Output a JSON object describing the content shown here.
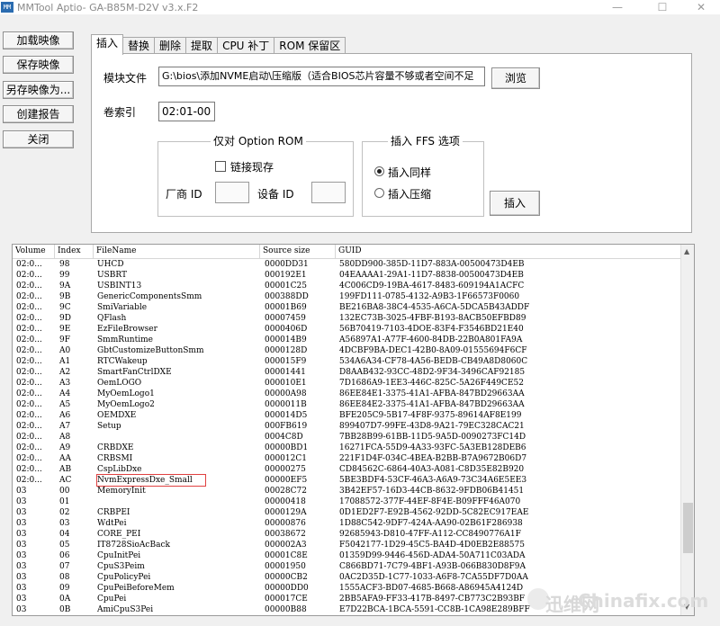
{
  "window": {
    "title": "MMTool Aptio- GA-B85M-D2V v3.x.F2",
    "icon_label": "MM",
    "controls": {
      "minimize": "—",
      "maximize": "☐",
      "close": "✕"
    }
  },
  "left_buttons": [
    "加载映像",
    "保存映像",
    "另存映像为...",
    "创建报告",
    "关闭"
  ],
  "tabs": [
    "插入",
    "替换",
    "删除",
    "提取",
    "CPU 补丁",
    "ROM 保留区"
  ],
  "active_tab": "插入",
  "insert_panel": {
    "module_file_label": "模块文件",
    "module_file_value": "G:\\bios\\添加NVME启动\\压缩版（适合BIOS芯片容量不够或者空间不足",
    "browse_button": "浏览",
    "volume_index_label": "卷索引",
    "volume_index_value": "02:01-00",
    "option_rom_group": {
      "title": "仅对 Option ROM",
      "link_existing": "链接现存",
      "vendor_id_label": "厂商 ID",
      "device_id_label": "设备 ID"
    },
    "ffs_group": {
      "title": "插入 FFS 选项",
      "option_same": "插入同样",
      "option_compress": "插入压缩"
    },
    "insert_button": "插入"
  },
  "table": {
    "headers": [
      "Volume",
      "Index",
      "FileName",
      "Source size",
      "GUID"
    ],
    "rows": [
      [
        "02:0...",
        "98",
        "UHCD",
        "0000DD31",
        "580DD900-385D-11D7-883A-00500473D4EB"
      ],
      [
        "02:0...",
        "99",
        "USBRT",
        "000192E1",
        "04EAAAA1-29A1-11D7-8838-00500473D4EB"
      ],
      [
        "02:0...",
        "9A",
        "USBINT13",
        "00001C25",
        "4C006CD9-19BA-4617-8483-609194A1ACFC"
      ],
      [
        "02:0...",
        "9B",
        "GenericComponentsSmm",
        "000388DD",
        "199FD111-0785-4132-A9B3-1F66573F0060"
      ],
      [
        "02:0...",
        "9C",
        "SmiVariable",
        "00001B69",
        "BE216BA8-38C4-4535-A6CA-5DCA5B43ADDF"
      ],
      [
        "02:0...",
        "9D",
        "QFlash",
        "00007459",
        "132EC73B-3025-4FBF-B193-8ACB50EFBD89"
      ],
      [
        "02:0...",
        "9E",
        "EzFileBrowser",
        "0000406D",
        "56B70419-7103-4DOE-83F4-F3546BD21E40"
      ],
      [
        "02:0...",
        "9F",
        "SmmRuntime",
        "000014B9",
        "A56897A1-A77F-4600-84DB-22B0A801FA9A"
      ],
      [
        "02:0...",
        "A0",
        "GbtCustomizeButtonSmm",
        "0000128D",
        "4DCBF9BA-DEC1-42B0-8A09-01555694F6CF"
      ],
      [
        "02:0...",
        "A1",
        "RTCWakeup",
        "000015F9",
        "534A6A34-CF78-4A56-BEDB-CB49A8D8060C"
      ],
      [
        "02:0...",
        "A2",
        "SmartFanCtrlDXE",
        "00001441",
        "D8AAB432-93CC-48D2-9F34-3496CAF92185"
      ],
      [
        "02:0...",
        "A3",
        "OemLOGO",
        "000010E1",
        "7D1686A9-1EE3-446C-825C-5A26F449CE52"
      ],
      [
        "02:0...",
        "A4",
        "MyOemLogo1",
        "00000A98",
        "86EE84E1-3375-41A1-AFBA-847BD29663AA"
      ],
      [
        "02:0...",
        "A5",
        "MyOemLogo2",
        "0000011B",
        "86EE84E2-3375-41A1-AFBA-847BD29663AA"
      ],
      [
        "02:0...",
        "A6",
        "OEMDXE",
        "000014D5",
        "BFE205C9-5B17-4F8F-9375-89614AF8E199"
      ],
      [
        "02:0...",
        "A7",
        "Setup",
        "000FB619",
        "899407D7-99FE-43D8-9A21-79EC328CAC21"
      ],
      [
        "02:0...",
        "A8",
        "",
        "0004C8D",
        "7BB28B99-61BB-11D5-9A5D-0090273FC14D"
      ],
      [
        "02:0...",
        "A9",
        "CRBDXE",
        "00000BD1",
        "16271FCA-55D9-4A33-93FC-5A3EB128DEB6"
      ],
      [
        "02:0...",
        "AA",
        "CRBSMI",
        "000012C1",
        "221F1D4F-034C-4BEA-B2BB-B7A9672B06D7"
      ],
      [
        "02:0...",
        "AB",
        "CspLibDxe",
        "00000275",
        "CD84562C-6864-40A3-A081-C8D35E82B920"
      ],
      [
        "02:0...",
        "AC",
        "NvmExpressDxe_Small",
        "00000EF5",
        "5BE3BDF4-53CF-46A3-A6A9-73C34A6E5EE3"
      ],
      [
        "03",
        "00",
        "MemoryInit",
        "00028C72",
        "3B42EF57-16D3-44CB-8632-9FDB06B41451"
      ],
      [
        "03",
        "01",
        "",
        "00000418",
        "17088572-377F-44EF-8F4E-B09FFF46A070"
      ],
      [
        "03",
        "02",
        "CRBPEI",
        "0000129A",
        "0D1ED2F7-E92B-4562-92DD-5C82EC917EAE"
      ],
      [
        "03",
        "03",
        "WdtPei",
        "00000876",
        "1D88C542-9DF7-424A-AA90-02B61F286938"
      ],
      [
        "03",
        "04",
        "CORE_PEI",
        "00038672",
        "92685943-D810-47FF-A112-CC8490776A1F"
      ],
      [
        "03",
        "05",
        "IT8728SioAcBack",
        "000002A3",
        "F5042177-1D29-45C5-BA4D-4D0EB2E88575"
      ],
      [
        "03",
        "06",
        "CpuInitPei",
        "00001C8E",
        "01359D99-9446-456D-ADA4-50A711C03ADA"
      ],
      [
        "03",
        "07",
        "CpuS3Peim",
        "00001950",
        "C866BD71-7C79-4BF1-A93B-066B830D8F9A"
      ],
      [
        "03",
        "08",
        "CpuPolicyPei",
        "00000CB2",
        "0AC2D35D-1C77-1033-A6F8-7CA55DF7D0AA"
      ],
      [
        "03",
        "09",
        "CpuPeiBeforeMem",
        "00000DD0",
        "1555ACF3-BD07-4685-B668-A86945A4124D"
      ],
      [
        "03",
        "0A",
        "CpuPei",
        "000017CE",
        "2BB5AFA9-FF33-417B-8497-CB773C2B93BF"
      ],
      [
        "03",
        "0B",
        "AmiCpuS3Pei",
        "00000B88",
        "E7D22BCA-1BCA-5591-CC8B-1CA98E289BFF"
      ]
    ]
  },
  "watermark": {
    "cn": "迅维网",
    "en": "Chinafix.com"
  }
}
